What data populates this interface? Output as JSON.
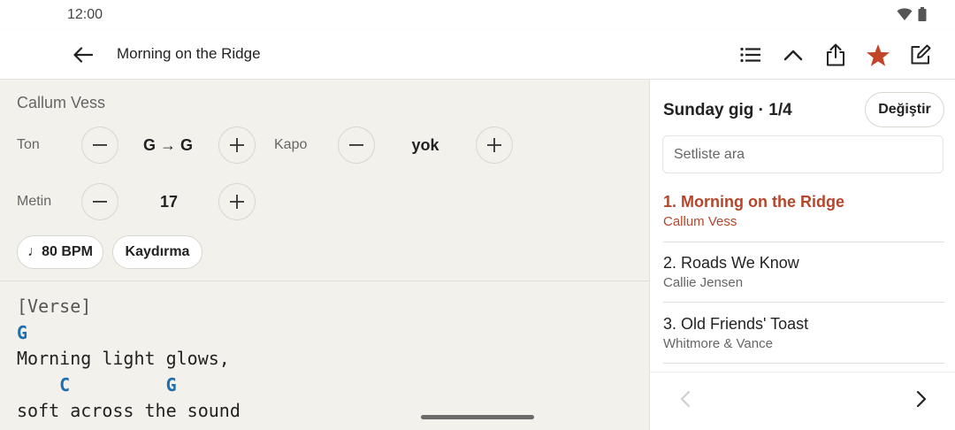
{
  "status": {
    "time": "12:00"
  },
  "header": {
    "title": "Morning on the Ridge",
    "icons": [
      "back-arrow-icon",
      "list-icon",
      "chevron-up-icon",
      "share-icon",
      "star-icon",
      "edit-icon"
    ],
    "favorite_color": "#c2452a"
  },
  "song": {
    "artist": "Callum Vess",
    "key": {
      "label": "Ton",
      "value": "G → G"
    },
    "capo": {
      "label": "Kapo",
      "value": "yok"
    },
    "text_size": {
      "label": "Metin",
      "value": "17"
    },
    "bpm_label": "♩80 BPM",
    "scroll_label": "Kaydırma",
    "sheet": {
      "section": "[Verse]",
      "chords_1": "G",
      "lyric_1": "Morning light glows,",
      "chords_2": "    C         G",
      "lyric_2": "soft across the sound"
    }
  },
  "setlist": {
    "title": "Sunday gig · 1/4",
    "change_label": "Değiştir",
    "search_placeholder": "Setliste ara",
    "items": [
      {
        "title": "1. Morning on the Ridge",
        "artist": "Callum Vess",
        "active": true
      },
      {
        "title": "2. Roads We Know",
        "artist": "Callie Jensen",
        "active": false
      },
      {
        "title": "3. Old Friends' Toast",
        "artist": "Whitmore & Vance",
        "active": false
      }
    ]
  },
  "colors": {
    "accent": "#b5462b",
    "chord": "#1f6fb0"
  }
}
